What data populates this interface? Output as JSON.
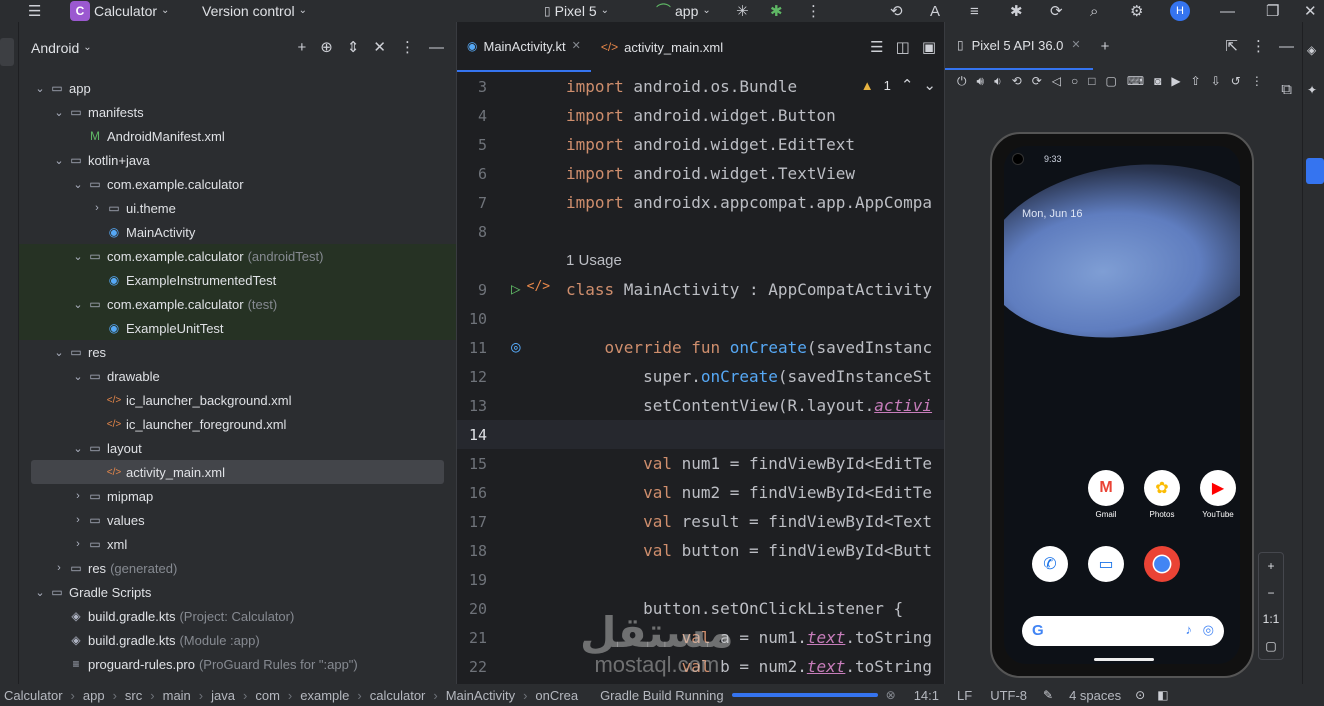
{
  "topbar": {
    "project_badge": "C",
    "project_name": "Calculator",
    "version_control": "Version control",
    "device": "Pixel 5",
    "run_config": "app",
    "avatar": "H"
  },
  "project_panel": {
    "title": "Android",
    "tree": [
      {
        "label": "app",
        "depth": 0
      },
      {
        "label": "manifests",
        "depth": 1
      },
      {
        "label": "AndroidManifest.xml",
        "depth": 2
      },
      {
        "label": "kotlin+java",
        "depth": 1
      },
      {
        "label": "com.example.calculator",
        "depth": 2
      },
      {
        "label": "ui.theme",
        "depth": 3
      },
      {
        "label": "MainActivity",
        "depth": 3
      },
      {
        "label": "com.example.calculator",
        "muted": "(androidTest)",
        "depth": 2
      },
      {
        "label": "ExampleInstrumentedTest",
        "depth": 3
      },
      {
        "label": "com.example.calculator",
        "muted": "(test)",
        "depth": 2
      },
      {
        "label": "ExampleUnitTest",
        "depth": 3
      },
      {
        "label": "res",
        "depth": 1
      },
      {
        "label": "drawable",
        "depth": 2
      },
      {
        "label": "ic_launcher_background.xml",
        "depth": 3
      },
      {
        "label": "ic_launcher_foreground.xml",
        "depth": 3
      },
      {
        "label": "layout",
        "depth": 2
      },
      {
        "label": "activity_main.xml",
        "depth": 3
      },
      {
        "label": "mipmap",
        "depth": 2
      },
      {
        "label": "values",
        "depth": 2
      },
      {
        "label": "xml",
        "depth": 2
      },
      {
        "label": "res",
        "muted": "(generated)",
        "depth": 1
      },
      {
        "label": "Gradle Scripts",
        "depth": 0
      },
      {
        "label": "build.gradle.kts",
        "muted": "(Project: Calculator)",
        "depth": 1
      },
      {
        "label": "build.gradle.kts",
        "muted": "(Module :app)",
        "depth": 1
      },
      {
        "label": "proguard-rules.pro",
        "muted": "(ProGuard Rules for \":app\")",
        "depth": 1
      }
    ]
  },
  "editor": {
    "tabs": [
      "MainActivity.kt",
      "activity_main.xml"
    ],
    "warning_count": "1",
    "usage_hint": "1 Usage",
    "lines": [
      {
        "n": "3",
        "code": "import android.os.Bundle"
      },
      {
        "n": "4",
        "code": "import android.widget.Button"
      },
      {
        "n": "5",
        "code": "import android.widget.EditText"
      },
      {
        "n": "6",
        "code": "import android.widget.TextView"
      },
      {
        "n": "7",
        "code": "import androidx.appcompat.app.AppCompa"
      },
      {
        "n": "8",
        "code": ""
      },
      {
        "n": "9",
        "code": "class MainActivity : AppCompatActivity"
      },
      {
        "n": "10",
        "code": ""
      },
      {
        "n": "11",
        "code": "    override fun onCreate(savedInstanc"
      },
      {
        "n": "12",
        "code": "        super.onCreate(savedInstanceSt"
      },
      {
        "n": "13",
        "code": "        setContentView(R.layout.activi"
      },
      {
        "n": "14",
        "code": ""
      },
      {
        "n": "15",
        "code": "        val num1 = findViewById<EditTe"
      },
      {
        "n": "16",
        "code": "        val num2 = findViewById<EditTe"
      },
      {
        "n": "17",
        "code": "        val result = findViewById<Text"
      },
      {
        "n": "18",
        "code": "        val button = findViewById<Butt"
      },
      {
        "n": "19",
        "code": ""
      },
      {
        "n": "20",
        "code": "        button.setOnClickListener {"
      },
      {
        "n": "21",
        "code": "            val a = num1.text.toString"
      },
      {
        "n": "22",
        "code": "            val b = num2.text.toString"
      }
    ]
  },
  "emulator": {
    "tab": "Pixel 5 API 36.0",
    "time": "9:33",
    "date": "Mon, Jun 16",
    "apps_row1": [
      "Gmail",
      "Photos",
      "YouTube"
    ],
    "zoom_label": "1:1"
  },
  "statusbar": {
    "crumbs": [
      "Calculator",
      "app",
      "src",
      "main",
      "java",
      "com",
      "example",
      "calculator",
      "MainActivity",
      "onCrea"
    ],
    "task": "Gradle Build Running",
    "position": "14:1",
    "line_sep": "LF",
    "encoding": "UTF-8",
    "indent": "4 spaces"
  },
  "watermark": {
    "arabic": "مستقل",
    "latin": "mostaql.com"
  },
  "colors": {
    "accent": "#3574f0",
    "keyword": "#cf8e6d",
    "function": "#56a8f5"
  }
}
